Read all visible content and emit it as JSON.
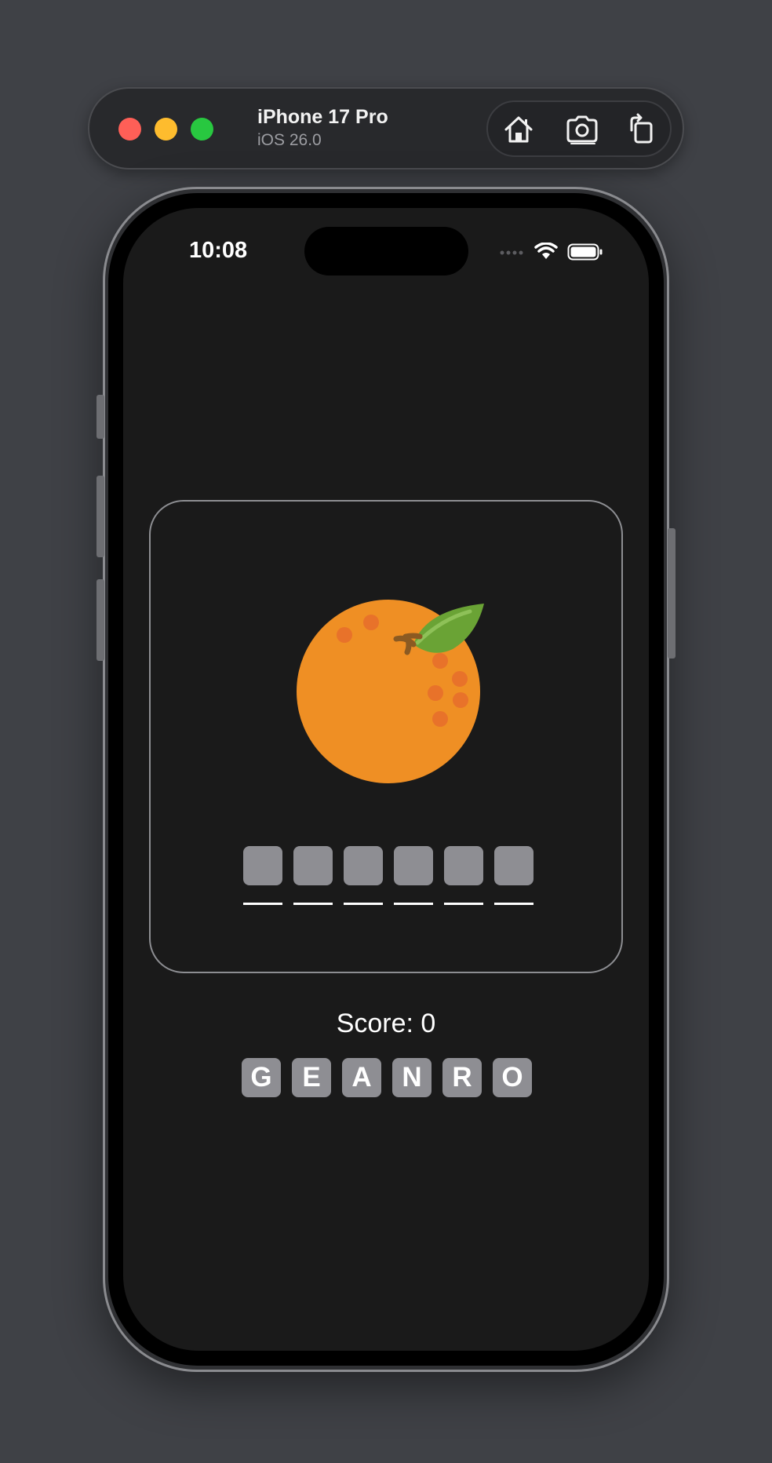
{
  "toolbar": {
    "device_name": "iPhone 17 Pro",
    "os_version": "iOS 26.0",
    "icons": [
      "home-icon",
      "screenshot-icon",
      "rotate-icon"
    ]
  },
  "status_bar": {
    "time": "10:08",
    "icons": [
      "signal-icon",
      "wifi-icon",
      "battery-icon"
    ]
  },
  "game": {
    "fruit_icon": "orange-icon",
    "answer_slot_count": 6,
    "score_text": "Score: 0",
    "letter_tiles": [
      "G",
      "E",
      "A",
      "N",
      "R",
      "O"
    ]
  },
  "colors": {
    "background": "#3f4146",
    "screen": "#1a1a1a",
    "tile": "#8e8e93",
    "fruit_orange": "#ef8f24",
    "leaf_green": "#6aa335"
  }
}
